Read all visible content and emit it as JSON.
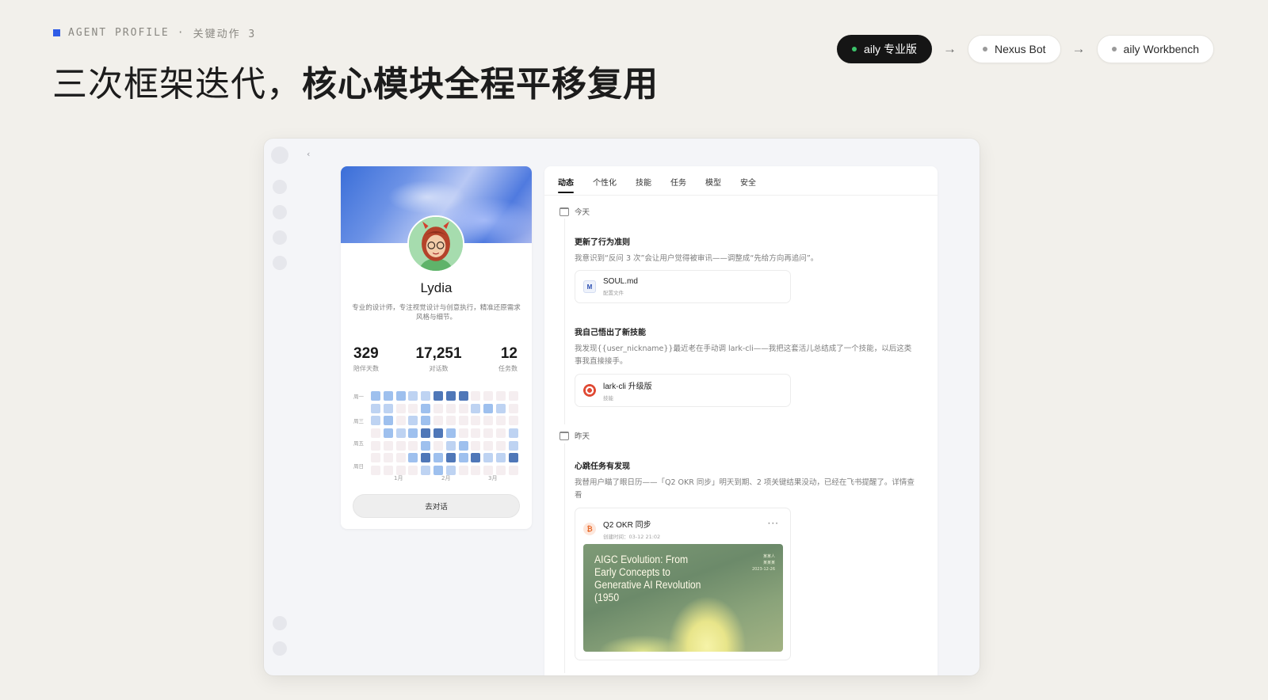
{
  "header": {
    "eyebrow_label": "AGENT PROFILE",
    "eyebrow_sep": "·",
    "eyebrow_step": "关键动作 3",
    "title_light": "三次框架迭代，",
    "title_bold": "核心模块全程平移复用",
    "accent_color": "#2f5ce6"
  },
  "pipeline": [
    {
      "label": "aily 专业版",
      "active": true,
      "dot_color": "#3cc36b"
    },
    {
      "label": "Nexus Bot",
      "active": false
    },
    {
      "label": "aily Workbench",
      "active": false
    }
  ],
  "pipeline_arrow": "→",
  "window": {
    "back_icon": "‹"
  },
  "profile": {
    "name": "Lydia",
    "description": "专业的设计师，专注视觉设计与创意执行，精准还原需求风格与细节。",
    "stats": [
      {
        "value": "329",
        "label": "陪伴天数"
      },
      {
        "value": "17,251",
        "label": "对话数"
      },
      {
        "value": "12",
        "label": "任务数"
      }
    ],
    "heatmap": {
      "day_labels": [
        "周一",
        "周三",
        "周五",
        "周日"
      ],
      "month_labels": [
        "1月",
        "2月",
        "3月"
      ],
      "levels": [
        [
          2,
          2,
          2,
          1,
          1,
          3,
          3,
          3,
          0,
          0,
          0,
          0
        ],
        [
          1,
          1,
          0,
          0,
          2,
          0,
          0,
          0,
          1,
          2,
          1,
          0
        ],
        [
          1,
          2,
          0,
          1,
          2,
          0,
          0,
          0,
          0,
          0,
          0,
          0
        ],
        [
          0,
          2,
          1,
          2,
          3,
          3,
          2,
          0,
          0,
          0,
          0,
          1
        ],
        [
          0,
          0,
          0,
          0,
          2,
          0,
          1,
          2,
          0,
          0,
          0,
          1
        ],
        [
          0,
          0,
          0,
          2,
          3,
          2,
          3,
          2,
          3,
          1,
          1,
          3
        ],
        [
          0,
          0,
          0,
          0,
          1,
          2,
          1,
          0,
          0,
          0,
          0,
          0
        ]
      ],
      "colors": {
        "0": "#f5eef0",
        "1": "#bed3f2",
        "2": "#9ec0ee",
        "3": "#4f77b8"
      }
    },
    "chat_button": "去对话"
  },
  "feed": {
    "tabs": [
      "动态",
      "个性化",
      "技能",
      "任务",
      "模型",
      "安全"
    ],
    "active_tab": "动态",
    "today": "今天",
    "yesterday": "昨天",
    "entries": [
      {
        "title": "更新了行为准则",
        "text": "我意识到“反问 3 次”会让用户觉得被审讯——调整成“先给方向再追问”。",
        "file": {
          "name": "SOUL.md",
          "sub": "配置文件",
          "icon": "markdown-icon",
          "glyph": "M"
        }
      },
      {
        "title": "我自己悟出了新技能",
        "text": "我发现{{user_nickname}}最近老在手动调 lark-cli——我把这套活儿总结成了一个技能，以后这类事我直接接手。",
        "file": {
          "name": "lark-cli 升级版",
          "sub": "技能",
          "icon": "target-icon"
        }
      },
      {
        "title": "心跳任务有发现",
        "text": "我替用户瞄了眼日历——「Q2 OKR 同步」明天到期、2 项关键结果没动，已经在飞书提醒了。详情查看",
        "file": {
          "name": "Q2 OKR 同步",
          "sub": "创建时间：03-12 21:02",
          "icon": "okr-icon",
          "glyph": "₿"
        },
        "more": "···",
        "slide": {
          "title": "AIGC Evolution: From Early Concepts to Generative AI Revolution (1950",
          "meta": [
            "某某人",
            "某某某",
            "2023-12-26"
          ]
        }
      }
    ]
  }
}
